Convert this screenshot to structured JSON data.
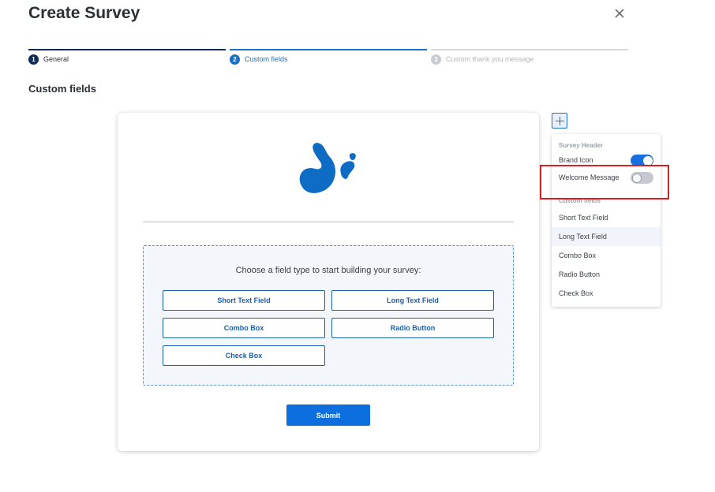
{
  "header": {
    "title": "Create Survey",
    "close_icon": "close-icon"
  },
  "steps": [
    {
      "number": "1",
      "label": "General",
      "state": "completed"
    },
    {
      "number": "2",
      "label": "Custom fields",
      "state": "active"
    },
    {
      "number": "3",
      "label": "Custom thank you message",
      "state": "pending"
    }
  ],
  "section_title": "Custom fields",
  "survey": {
    "logo_icon": "splash-logo-icon",
    "prompt": "Choose a field type to start building your survey:",
    "field_buttons": [
      "Short Text Field",
      "Long Text Field",
      "Combo Box",
      "Radio Button",
      "Check Box"
    ],
    "submit_label": "Submit"
  },
  "panel": {
    "header_section": "Survey Header",
    "toggles": [
      {
        "label": "Brand Icon",
        "on": true
      },
      {
        "label": "Welcome Message",
        "on": false
      }
    ],
    "custom_section": "Custom fields",
    "items": [
      "Short Text Field",
      "Long Text Field",
      "Combo Box",
      "Radio Button",
      "Check Box"
    ]
  },
  "colors": {
    "primary": "#0d6fde",
    "step_done": "#0e2b5c",
    "step_active": "#1a6fc9",
    "highlight": "#d62020"
  }
}
